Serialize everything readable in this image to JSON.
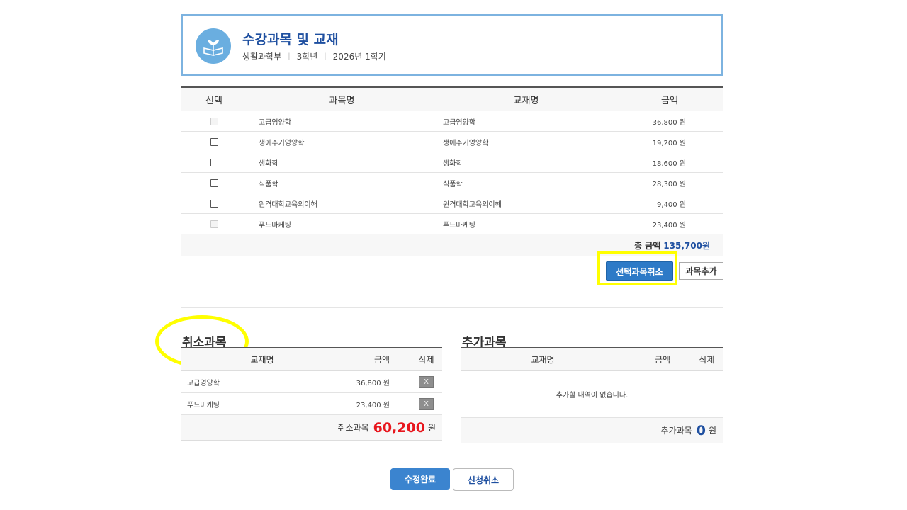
{
  "header": {
    "title": "수강과목 및 교재",
    "department": "생활과학부",
    "grade": "3학년",
    "term": "2026년 1학기"
  },
  "course_table": {
    "headers": {
      "select": "선택",
      "subject": "과목명",
      "textbook": "교재명",
      "amount": "금액"
    },
    "rows": [
      {
        "subject": "고급영양학",
        "textbook": "고급영양학",
        "amount": "36,800 원",
        "disabled": true
      },
      {
        "subject": "생애주기영양학",
        "textbook": "생애주기영양학",
        "amount": "19,200 원",
        "disabled": false
      },
      {
        "subject": "생화학",
        "textbook": "생화학",
        "amount": "18,600 원",
        "disabled": false
      },
      {
        "subject": "식품학",
        "textbook": "식품학",
        "amount": "28,300 원",
        "disabled": false
      },
      {
        "subject": "원격대학교육의이해",
        "textbook": "원격대학교육의이해",
        "amount": "9,400 원",
        "disabled": false
      },
      {
        "subject": "푸드마케팅",
        "textbook": "푸드마케팅",
        "amount": "23,400 원",
        "disabled": true
      }
    ],
    "total_label": "총 금액",
    "total_value": "135,700원"
  },
  "actions": {
    "cancel_selected": "선택과목취소",
    "add_subject": "과목추가"
  },
  "cancelled": {
    "title": "취소과목",
    "headers": {
      "textbook": "교재명",
      "amount": "금액",
      "delete": "삭제"
    },
    "rows": [
      {
        "textbook": "고급영양학",
        "amount": "36,800 원",
        "delete": "X"
      },
      {
        "textbook": "푸드마케팅",
        "amount": "23,400 원",
        "delete": "X"
      }
    ],
    "total_label": "취소과목",
    "total_value": "60,200",
    "unit": "원"
  },
  "added": {
    "title": "추가과목",
    "headers": {
      "textbook": "교재명",
      "amount": "금액",
      "delete": "삭제"
    },
    "empty_text": "추가할 내역이 없습니다.",
    "total_label": "추가과목",
    "total_value": "0",
    "unit": "원"
  },
  "footer": {
    "complete": "수정완료",
    "cancel_application": "신청취소"
  },
  "colors": {
    "accent": "#1e4fa0",
    "primary_button": "#2d7ac7",
    "cancel_total": "#e8161d",
    "highlight": "#ffff00"
  }
}
